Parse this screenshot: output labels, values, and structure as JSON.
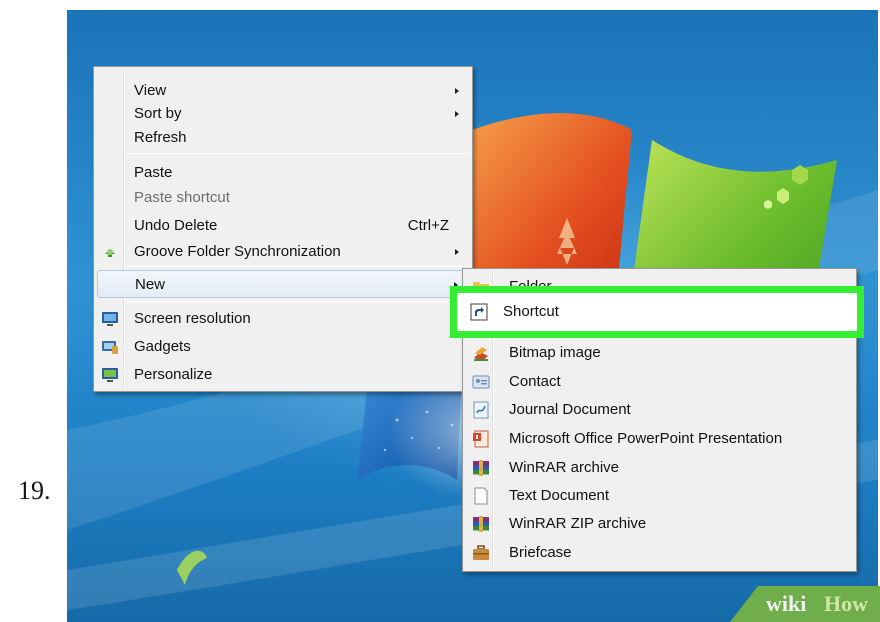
{
  "step_number": "19.",
  "main_menu": {
    "items": [
      {
        "label": "View",
        "submenu": true
      },
      {
        "label": "Sort by",
        "submenu": true
      },
      {
        "label": "Refresh"
      },
      {
        "label": "Paste"
      },
      {
        "label": "Paste shortcut",
        "disabled": true
      },
      {
        "label": "Undo Delete",
        "shortcut": "Ctrl+Z"
      },
      {
        "label": "Groove Folder Synchronization",
        "submenu": true,
        "icon": "groove-icon"
      },
      {
        "label": "New",
        "submenu": true,
        "highlighted": true
      },
      {
        "label": "Screen resolution",
        "icon": "monitor-icon"
      },
      {
        "label": "Gadgets",
        "icon": "gadgets-icon"
      },
      {
        "label": "Personalize",
        "icon": "personalize-icon"
      }
    ]
  },
  "new_submenu": {
    "items": [
      {
        "label": "Folder",
        "icon": "folder-icon"
      },
      {
        "label": "Shortcut",
        "icon": "shortcut-icon",
        "highlighted": true
      },
      {
        "label": "Bitmap image",
        "icon": "paint-icon"
      },
      {
        "label": "Contact",
        "icon": "contact-card-icon"
      },
      {
        "label": "Journal Document",
        "icon": "journal-icon"
      },
      {
        "label": "Microsoft Office PowerPoint Presentation",
        "icon": "powerpoint-icon"
      },
      {
        "label": "WinRAR archive",
        "icon": "winrar-icon"
      },
      {
        "label": "Text Document",
        "icon": "text-document-icon"
      },
      {
        "label": "WinRAR ZIP archive",
        "icon": "winrar-zip-icon"
      },
      {
        "label": "Briefcase",
        "icon": "briefcase-icon"
      }
    ]
  },
  "watermark": {
    "part1": "wiki",
    "part2": "How"
  },
  "colors": {
    "highlight": "#33ee33",
    "menu_bg": "#f0f0f0",
    "desktop": "#2f93d3"
  }
}
